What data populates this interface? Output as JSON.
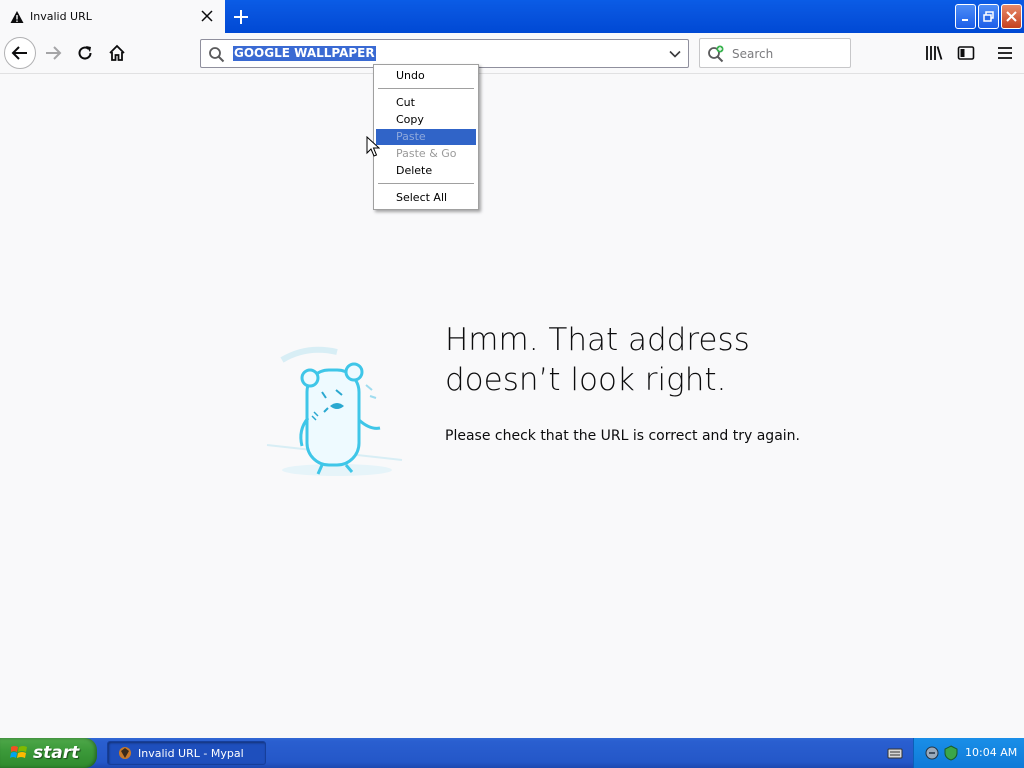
{
  "tab": {
    "title": "Invalid URL"
  },
  "urlbar": {
    "value": "GOOGLE WALLPAPER"
  },
  "searchbar": {
    "placeholder": "Search"
  },
  "context_menu": {
    "items": [
      {
        "label": "Undo",
        "state": "enabled"
      },
      {
        "label": "Cut",
        "state": "enabled"
      },
      {
        "label": "Copy",
        "state": "enabled"
      },
      {
        "label": "Paste",
        "state": "highlighted-disabled"
      },
      {
        "label": "Paste & Go",
        "state": "disabled"
      },
      {
        "label": "Delete",
        "state": "enabled"
      },
      {
        "label": "Select All",
        "state": "enabled"
      }
    ]
  },
  "error": {
    "title": "Hmm. That address doesn’t look right.",
    "description": "Please check that the URL is correct and try again."
  },
  "taskbar": {
    "start_label": "start",
    "task_label": "Invalid URL - Mypal",
    "clock": "10:04 AM"
  },
  "colors": {
    "titlebar_blue": "#0054e3",
    "selection_blue": "#3a6ad3",
    "start_green": "#3c9a3a",
    "tray_blue": "#0f7ad8"
  }
}
